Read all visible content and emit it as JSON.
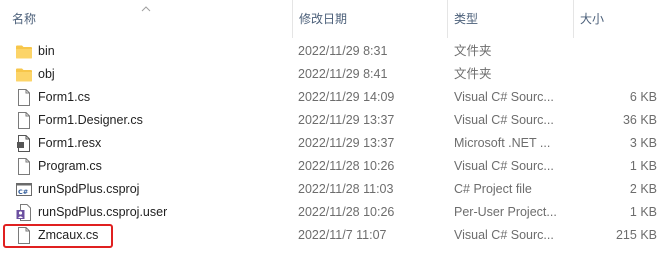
{
  "columns": {
    "name": "名称",
    "date": "修改日期",
    "type": "类型",
    "size": "大小"
  },
  "files": [
    {
      "name": "bin",
      "date": "2022/11/29 8:31",
      "type": "文件夹",
      "size": "",
      "icon": "folder-icon"
    },
    {
      "name": "obj",
      "date": "2022/11/29 8:41",
      "type": "文件夹",
      "size": "",
      "icon": "folder-icon"
    },
    {
      "name": "Form1.cs",
      "date": "2022/11/29 14:09",
      "type": "Visual C# Sourc...",
      "size": "6 KB",
      "icon": "document-icon"
    },
    {
      "name": "Form1.Designer.cs",
      "date": "2022/11/29 13:37",
      "type": "Visual C# Sourc...",
      "size": "36 KB",
      "icon": "document-icon"
    },
    {
      "name": "Form1.resx",
      "date": "2022/11/29 13:37",
      "type": "Microsoft .NET ...",
      "size": "3 KB",
      "icon": "resx-icon"
    },
    {
      "name": "Program.cs",
      "date": "2022/11/28 10:26",
      "type": "Visual C# Sourc...",
      "size": "1 KB",
      "icon": "document-icon"
    },
    {
      "name": "runSpdPlus.csproj",
      "date": "2022/11/28 11:03",
      "type": "C# Project file",
      "size": "2 KB",
      "icon": "csproj-icon"
    },
    {
      "name": "runSpdPlus.csproj.user",
      "date": "2022/11/28 10:26",
      "type": "Per-User Project...",
      "size": "1 KB",
      "icon": "user-file-icon"
    },
    {
      "name": "Zmcaux.cs",
      "date": "2022/11/7 11:07",
      "type": "Visual C# Sourc...",
      "size": "215 KB",
      "icon": "document-icon"
    }
  ],
  "colors": {
    "header_text": "#4c607a",
    "folder": "#f7c64a",
    "highlight": "#e02020"
  }
}
